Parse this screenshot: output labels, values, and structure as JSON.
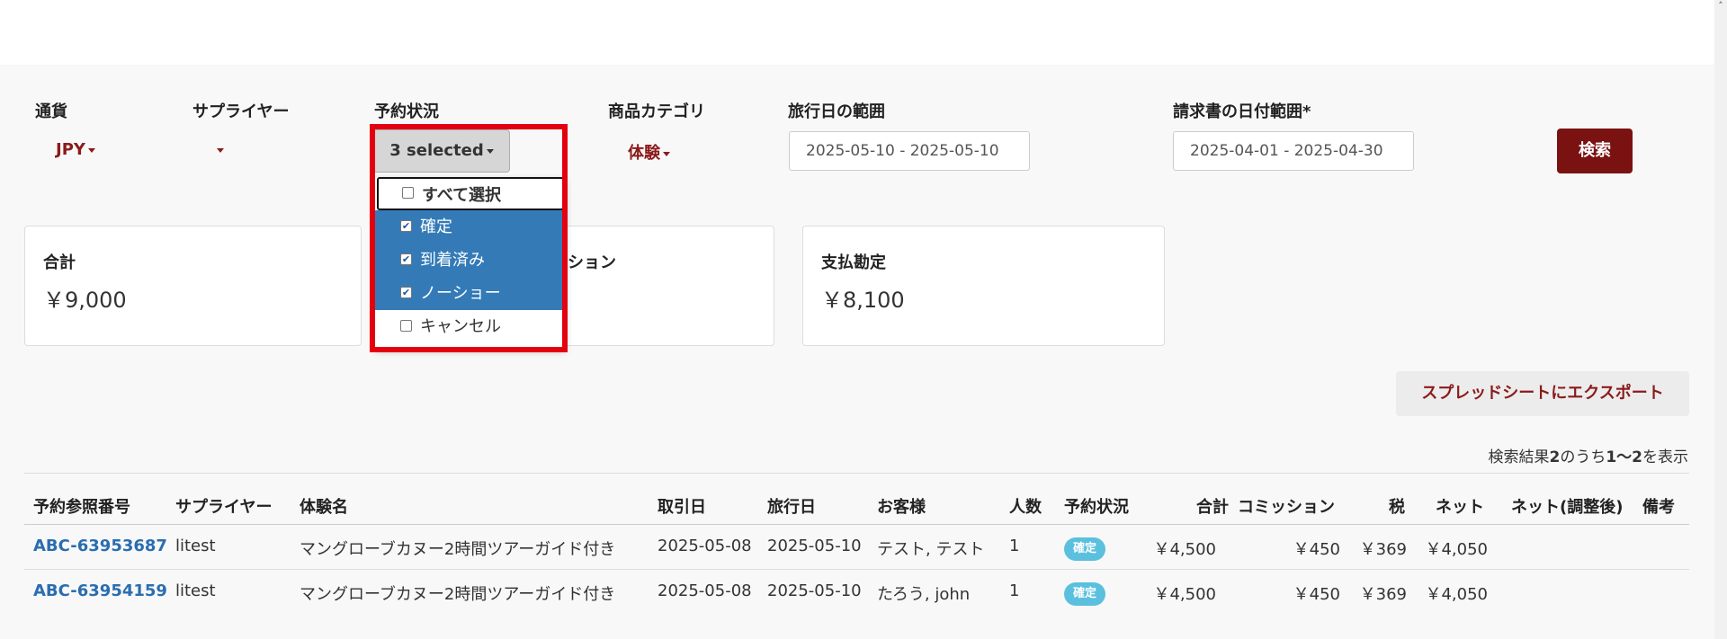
{
  "filters": {
    "currency": {
      "label": "通貨",
      "value": "JPY"
    },
    "supplier": {
      "label": "サプライヤー",
      "value": ""
    },
    "status": {
      "label": "予約状況",
      "button_label": "3 selected",
      "options": [
        {
          "label": "すべて選択",
          "checked": false
        },
        {
          "label": "確定",
          "checked": true
        },
        {
          "label": "到着済み",
          "checked": true
        },
        {
          "label": "ノーショー",
          "checked": true
        },
        {
          "label": "キャンセル",
          "checked": false
        }
      ]
    },
    "category": {
      "label": "商品カテゴリ",
      "value": "体験"
    },
    "travel_range": {
      "label": "旅行日の範囲",
      "value": "2025-05-10 - 2025-05-10"
    },
    "invoice_range": {
      "label": "請求書の日付範囲*",
      "value": "2025-04-01 - 2025-04-30"
    },
    "search_label": "検索"
  },
  "summary": [
    {
      "title": "合計",
      "value": "￥9,000"
    },
    {
      "title": "ション",
      "value": ""
    },
    {
      "title": "支払勘定",
      "value": "￥8,100"
    }
  ],
  "export_label": "スプレッドシートにエクスポート",
  "result_info": {
    "prefix": "検索結果",
    "total": "2",
    "mid": "のうち",
    "range": "1〜2",
    "suffix": "を表示"
  },
  "table": {
    "headers": [
      "予約参照番号",
      "サプライヤー",
      "体験名",
      "取引日",
      "旅行日",
      "お客様",
      "人数",
      "予約状況",
      "合計",
      "コミッション",
      "税",
      "ネット",
      "ネット(調整後)",
      "備考"
    ],
    "rows": [
      {
        "ref": "ABC-63953687",
        "supplier": "litest",
        "name": "マングローブカヌー2時間ツアーガイド付き",
        "deal_date": "2025-05-08",
        "travel_date": "2025-05-10",
        "customer": "テスト, テスト",
        "people": "1",
        "status": "確定",
        "total": "￥4,500",
        "commission": "￥450",
        "tax": "￥369",
        "net": "￥4,050",
        "net_adj": "",
        "note": ""
      },
      {
        "ref": "ABC-63954159",
        "supplier": "litest",
        "name": "マングローブカヌー2時間ツアーガイド付き",
        "deal_date": "2025-05-08",
        "travel_date": "2025-05-10",
        "customer": "たろう, john",
        "people": "1",
        "status": "確定",
        "total": "￥4,500",
        "commission": "￥450",
        "tax": "￥369",
        "net": "￥4,050",
        "net_adj": "",
        "note": ""
      }
    ]
  }
}
